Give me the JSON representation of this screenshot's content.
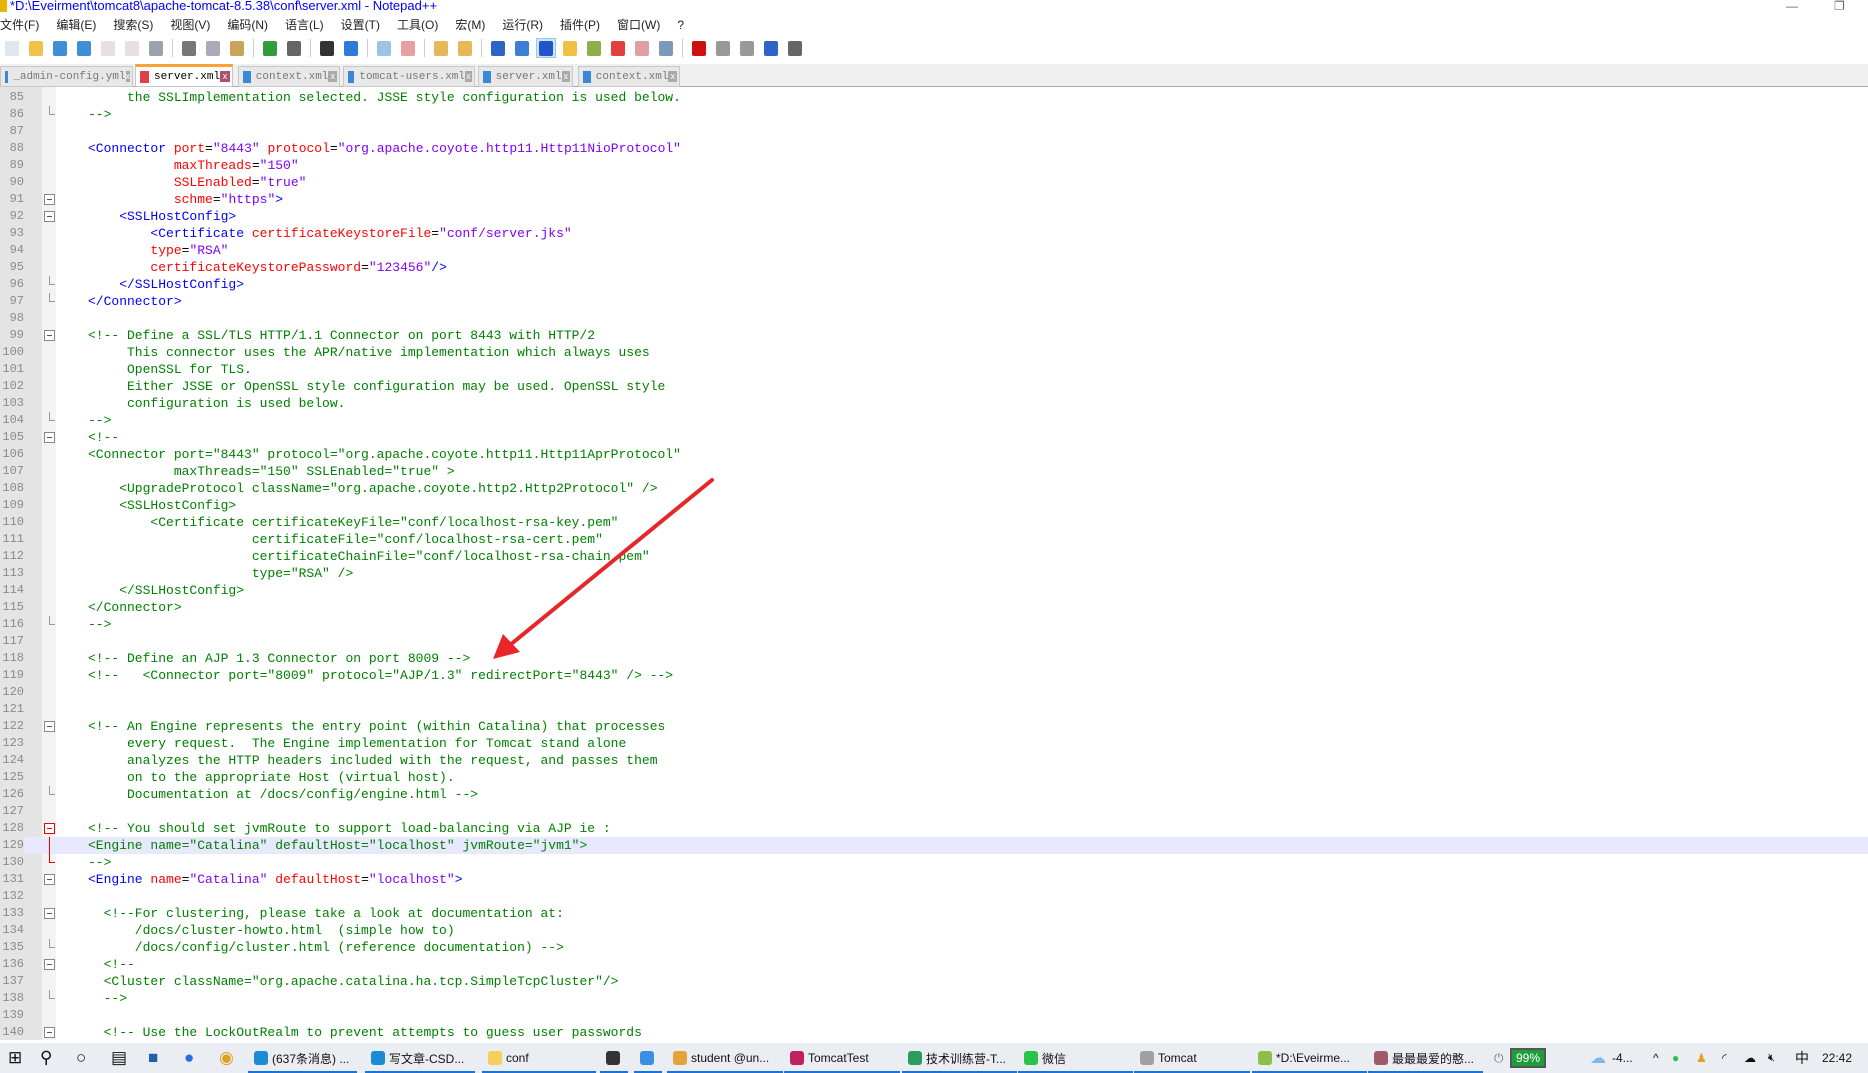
{
  "window": {
    "title": "*D:\\Eveirment\\tomcat8\\apache-tomcat-8.5.38\\conf\\server.xml - Notepad++",
    "minimize": "—",
    "restore": "❐"
  },
  "menu": [
    "文件(F)",
    "编辑(E)",
    "搜索(S)",
    "视图(V)",
    "编码(N)",
    "语言(L)",
    "设置(T)",
    "工具(O)",
    "宏(M)",
    "运行(R)",
    "插件(P)",
    "窗口(W)",
    "?"
  ],
  "toolbar": [
    {
      "icon": "new-file-icon",
      "color": "#dfe6ee"
    },
    {
      "icon": "open-file-icon",
      "color": "#f2c24a"
    },
    {
      "icon": "save-icon",
      "color": "#3e8fd6"
    },
    {
      "icon": "save-all-icon",
      "color": "#3e8fd6"
    },
    {
      "icon": "close-icon",
      "color": "#e8e0e0"
    },
    {
      "icon": "close-all-icon",
      "color": "#e8e0e0"
    },
    {
      "icon": "print-icon",
      "color": "#9aa3ad"
    },
    "sep",
    {
      "icon": "cut-icon",
      "color": "#777"
    },
    {
      "icon": "copy-icon",
      "color": "#aab"
    },
    {
      "icon": "paste-icon",
      "color": "#c9a35a"
    },
    "sep",
    {
      "icon": "undo-icon",
      "color": "#2f9d3a"
    },
    {
      "icon": "redo-icon",
      "color": "#666"
    },
    "sep",
    {
      "icon": "find-icon",
      "color": "#333"
    },
    {
      "icon": "replace-icon",
      "color": "#2d7bd6"
    },
    "sep",
    {
      "icon": "zoom-in-icon",
      "color": "#9ac3e6"
    },
    {
      "icon": "zoom-out-icon",
      "color": "#e6a0a0"
    },
    "sep",
    {
      "icon": "sync-vertical-icon",
      "color": "#e6b85a"
    },
    {
      "icon": "sync-horizontal-icon",
      "color": "#e6b85a"
    },
    "sep",
    {
      "icon": "word-wrap-icon",
      "color": "#2d64c8"
    },
    {
      "icon": "show-all-chars-icon",
      "color": "#3b7fd6"
    },
    {
      "icon": "indent-guide-icon",
      "color": "#2255cc",
      "active": true
    },
    {
      "icon": "udl-icon",
      "color": "#f0c040"
    },
    {
      "icon": "doc-map-icon",
      "color": "#8bb04a"
    },
    {
      "icon": "function-list-icon",
      "color": "#e04040"
    },
    {
      "icon": "folder-workspace-icon",
      "color": "#e0a0a0"
    },
    {
      "icon": "monitoring-icon",
      "color": "#7a9ab8"
    },
    "sep",
    {
      "icon": "record-macro-icon",
      "color": "#d01010"
    },
    {
      "icon": "stop-macro-icon",
      "color": "#999"
    },
    {
      "icon": "play-macro-icon",
      "color": "#999"
    },
    {
      "icon": "run-macro-multiple-icon",
      "color": "#2d64c8"
    },
    {
      "icon": "save-macro-icon",
      "color": "#666"
    }
  ],
  "tabs": [
    {
      "label": "_admin-config.yml",
      "active": false
    },
    {
      "label": "server.xml",
      "active": true
    },
    {
      "label": "context.xml",
      "active": false
    },
    {
      "label": "tomcat-users.xml",
      "active": false
    },
    {
      "label": "server.xml",
      "active": false
    },
    {
      "label": "context.xml",
      "active": false
    }
  ],
  "tab_close": "x",
  "colors": {
    "comment": "#008000",
    "tag": "#0000ff",
    "attribute": "#ff0000",
    "value": "#8000ff",
    "current_line": "#e8e8ff",
    "annotation_arrow": "#e8262a"
  },
  "current_line": 129,
  "lines": [
    {
      "n": "85",
      "t": [
        [
          "c",
          "     the SSLImplementation selected. JSSE style configuration is used below."
        ]
      ]
    },
    {
      "n": "86",
      "fold": "end",
      "t": [
        [
          "c",
          "-->"
        ]
      ]
    },
    {
      "n": "87",
      "t": []
    },
    {
      "n": "88",
      "t": [
        [
          "t",
          "<Connector "
        ],
        [
          "a",
          "port"
        ],
        [
          "p",
          "="
        ],
        [
          "v",
          "\"8443\""
        ],
        [
          "p",
          " "
        ],
        [
          "a",
          "protocol"
        ],
        [
          "p",
          "="
        ],
        [
          "v",
          "\"org.apache.coyote.http11.Http11NioProtocol\""
        ]
      ]
    },
    {
      "n": "89",
      "t": [
        [
          "p",
          "           "
        ],
        [
          "a",
          "maxThreads"
        ],
        [
          "p",
          "="
        ],
        [
          "v",
          "\"150\""
        ]
      ]
    },
    {
      "n": "90",
      "t": [
        [
          "p",
          "           "
        ],
        [
          "a",
          "SSLEnabled"
        ],
        [
          "p",
          "="
        ],
        [
          "v",
          "\"true\""
        ]
      ]
    },
    {
      "n": "91",
      "fold": "open",
      "t": [
        [
          "p",
          "           "
        ],
        [
          "a",
          "schme"
        ],
        [
          "p",
          "="
        ],
        [
          "v",
          "\"https\""
        ],
        [
          "t",
          ">"
        ]
      ]
    },
    {
      "n": "92",
      "fold": "open",
      "t": [
        [
          "t",
          "    <SSLHostConfig>"
        ]
      ]
    },
    {
      "n": "93",
      "t": [
        [
          "t",
          "        <Certificate "
        ],
        [
          "a",
          "certificateKeystoreFile"
        ],
        [
          "p",
          "="
        ],
        [
          "v",
          "\"conf/server.jks\""
        ]
      ]
    },
    {
      "n": "94",
      "t": [
        [
          "p",
          "        "
        ],
        [
          "a",
          "type"
        ],
        [
          "p",
          "="
        ],
        [
          "v",
          "\"RSA\""
        ]
      ]
    },
    {
      "n": "95",
      "t": [
        [
          "p",
          "        "
        ],
        [
          "a",
          "certificateKeystorePassword"
        ],
        [
          "p",
          "="
        ],
        [
          "v",
          "\"123456\""
        ],
        [
          "t",
          "/>"
        ]
      ]
    },
    {
      "n": "96",
      "fold": "end",
      "t": [
        [
          "t",
          "    </SSLHostConfig>"
        ]
      ]
    },
    {
      "n": "97",
      "fold": "end",
      "t": [
        [
          "t",
          "</Connector>"
        ]
      ]
    },
    {
      "n": "98",
      "t": []
    },
    {
      "n": "99",
      "fold": "open",
      "t": [
        [
          "c",
          "<!-- Define a SSL/TLS HTTP/1.1 Connector on port 8443 with HTTP/2"
        ]
      ]
    },
    {
      "n": "100",
      "t": [
        [
          "c",
          "     This connector uses the APR/native implementation which always uses"
        ]
      ]
    },
    {
      "n": "101",
      "t": [
        [
          "c",
          "     OpenSSL for TLS."
        ]
      ]
    },
    {
      "n": "102",
      "t": [
        [
          "c",
          "     Either JSSE or OpenSSL style configuration may be used. OpenSSL style"
        ]
      ]
    },
    {
      "n": "103",
      "t": [
        [
          "c",
          "     configuration is used below."
        ]
      ]
    },
    {
      "n": "104",
      "fold": "end",
      "t": [
        [
          "c",
          "-->"
        ]
      ]
    },
    {
      "n": "105",
      "fold": "open",
      "t": [
        [
          "c",
          "<!--"
        ]
      ]
    },
    {
      "n": "106",
      "t": [
        [
          "c",
          "<Connector port=\"8443\" protocol=\"org.apache.coyote.http11.Http11AprProtocol\""
        ]
      ]
    },
    {
      "n": "107",
      "t": [
        [
          "c",
          "           maxThreads=\"150\" SSLEnabled=\"true\" >"
        ]
      ]
    },
    {
      "n": "108",
      "t": [
        [
          "c",
          "    <UpgradeProtocol className=\"org.apache.coyote.http2.Http2Protocol\" />"
        ]
      ]
    },
    {
      "n": "109",
      "t": [
        [
          "c",
          "    <SSLHostConfig>"
        ]
      ]
    },
    {
      "n": "110",
      "t": [
        [
          "c",
          "        <Certificate certificateKeyFile=\"conf/localhost-rsa-key.pem\""
        ]
      ]
    },
    {
      "n": "111",
      "t": [
        [
          "c",
          "                     certificateFile=\"conf/localhost-rsa-cert.pem\""
        ]
      ]
    },
    {
      "n": "112",
      "t": [
        [
          "c",
          "                     certificateChainFile=\"conf/localhost-rsa-chain.pem\""
        ]
      ]
    },
    {
      "n": "113",
      "t": [
        [
          "c",
          "                     type=\"RSA\" />"
        ]
      ]
    },
    {
      "n": "114",
      "t": [
        [
          "c",
          "    </SSLHostConfig>"
        ]
      ]
    },
    {
      "n": "115",
      "t": [
        [
          "c",
          "</Connector>"
        ]
      ]
    },
    {
      "n": "116",
      "fold": "end",
      "t": [
        [
          "c",
          "-->"
        ]
      ]
    },
    {
      "n": "117",
      "t": []
    },
    {
      "n": "118",
      "t": [
        [
          "c",
          "<!-- Define an AJP 1.3 Connector on port 8009 -->"
        ]
      ]
    },
    {
      "n": "119",
      "t": [
        [
          "c",
          "<!--   <Connector port=\"8009\" protocol=\"AJP/1.3\" redirectPort=\"8443\" /> -->"
        ]
      ]
    },
    {
      "n": "120",
      "t": []
    },
    {
      "n": "121",
      "t": []
    },
    {
      "n": "122",
      "fold": "open",
      "t": [
        [
          "c",
          "<!-- An Engine represents the entry point (within Catalina) that processes"
        ]
      ]
    },
    {
      "n": "123",
      "t": [
        [
          "c",
          "     every request.  The Engine implementation for Tomcat stand alone"
        ]
      ]
    },
    {
      "n": "124",
      "t": [
        [
          "c",
          "     analyzes the HTTP headers included with the request, and passes them"
        ]
      ]
    },
    {
      "n": "125",
      "t": [
        [
          "c",
          "     on to the appropriate Host (virtual host)."
        ]
      ]
    },
    {
      "n": "126",
      "fold": "end",
      "t": [
        [
          "c",
          "     Documentation at /docs/config/engine.html -->"
        ]
      ]
    },
    {
      "n": "127",
      "t": []
    },
    {
      "n": "128",
      "fold": "open-red",
      "t": [
        [
          "c",
          "<!-- You should set jvmRoute to support load-balancing via AJP ie :"
        ]
      ]
    },
    {
      "n": "129",
      "fold": "line-red",
      "t": [
        [
          "c",
          "<Engine name=\"Catalina\" defaultHost=\"localhost\" jvmRoute=\"jvm1\">"
        ]
      ]
    },
    {
      "n": "130",
      "fold": "end-red",
      "t": [
        [
          "c",
          "-->"
        ]
      ]
    },
    {
      "n": "131",
      "fold": "open",
      "t": [
        [
          "t",
          "<Engine "
        ],
        [
          "a",
          "name"
        ],
        [
          "p",
          "="
        ],
        [
          "v",
          "\"Catalina\""
        ],
        [
          "p",
          " "
        ],
        [
          "a",
          "defaultHost"
        ],
        [
          "p",
          "="
        ],
        [
          "v",
          "\"localhost\""
        ],
        [
          "t",
          ">"
        ]
      ]
    },
    {
      "n": "132",
      "t": []
    },
    {
      "n": "133",
      "fold": "open",
      "t": [
        [
          "c",
          "  <!--For clustering, please take a look at documentation at:"
        ]
      ]
    },
    {
      "n": "134",
      "t": [
        [
          "c",
          "      /docs/cluster-howto.html  (simple how to)"
        ]
      ]
    },
    {
      "n": "135",
      "fold": "end",
      "t": [
        [
          "c",
          "      /docs/config/cluster.html (reference documentation) -->"
        ]
      ]
    },
    {
      "n": "136",
      "fold": "open",
      "t": [
        [
          "c",
          "  <!--"
        ]
      ]
    },
    {
      "n": "137",
      "t": [
        [
          "c",
          "  <Cluster className=\"org.apache.catalina.ha.tcp.SimpleTcpCluster\"/>"
        ]
      ]
    },
    {
      "n": "138",
      "fold": "end",
      "t": [
        [
          "c",
          "  -->"
        ]
      ]
    },
    {
      "n": "139",
      "t": []
    },
    {
      "n": "140",
      "fold": "open",
      "t": [
        [
          "c",
          "  <!-- Use the LockOutRealm to prevent attempts to guess user passwords"
        ]
      ]
    }
  ],
  "taskbar": {
    "system": [
      {
        "icon": "windows-start-icon"
      },
      {
        "icon": "search-icon"
      },
      {
        "icon": "cortana-icon"
      },
      {
        "icon": "task-view-icon"
      },
      {
        "icon": "store-icon"
      },
      {
        "icon": "app-l-icon"
      },
      {
        "icon": "chrome-icon"
      }
    ],
    "apps": [
      {
        "label": "(637条消息) ...",
        "icon": "edge-icon",
        "color": "#1c8bd6"
      },
      {
        "label": "写文章-CSD...",
        "icon": "edge-icon",
        "color": "#1c8bd6"
      },
      {
        "label": "conf",
        "icon": "folder-icon",
        "color": "#f4cf5a"
      },
      {
        "label": "",
        "icon": "terminal-icon",
        "color": "#333"
      },
      {
        "label": "",
        "icon": "vscode-icon",
        "color": "#3a8ee6"
      },
      {
        "label": "student @un...",
        "icon": "chrome-icon",
        "color": "#e6a23a"
      },
      {
        "label": "TomcatTest",
        "icon": "intellij-icon",
        "color": "#c02060"
      },
      {
        "label": "技术训练营-T...",
        "icon": "app-icon",
        "color": "#2a9d5a"
      },
      {
        "label": "微信",
        "icon": "wechat-icon",
        "color": "#2ac24a"
      },
      {
        "label": "Tomcat",
        "icon": "java-icon",
        "color": "#a0a0a0"
      },
      {
        "label": "*D:\\Eveirme...",
        "icon": "notepad-plus-plus-icon",
        "color": "#8bbf4a"
      },
      {
        "label": "最最最爱的憨...",
        "icon": "music-icon",
        "color": "#a05a6a"
      }
    ],
    "battery": "99%",
    "weather": "-4...",
    "tray_chevron": "^",
    "ime": "中",
    "time": "22:42"
  }
}
